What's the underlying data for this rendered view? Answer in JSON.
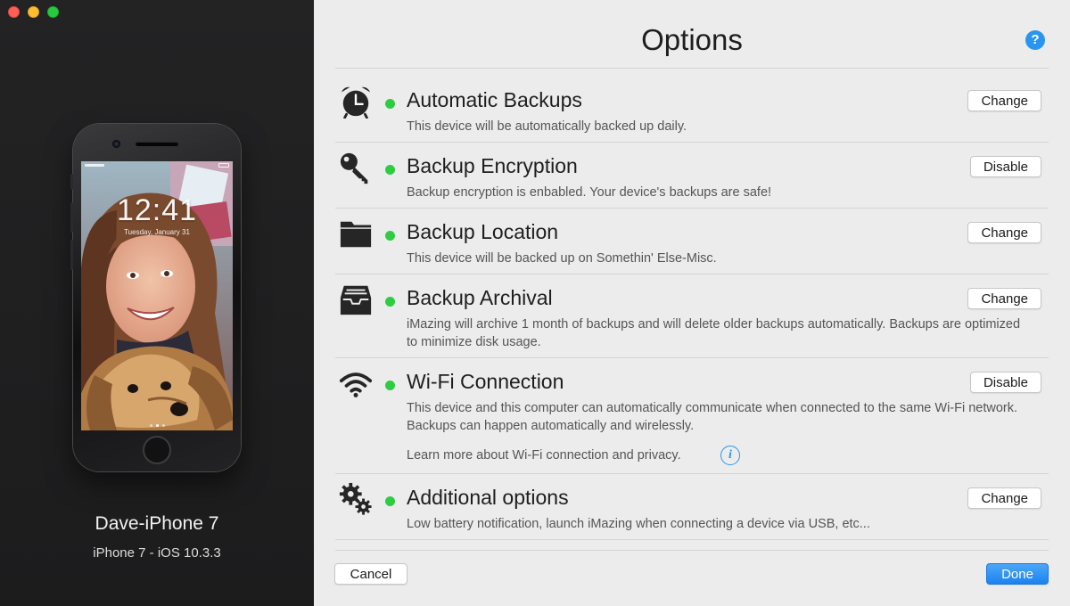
{
  "window": {
    "controls": [
      "close",
      "minimize",
      "maximize"
    ]
  },
  "device": {
    "name": "Dave-iPhone 7",
    "model": "iPhone 7 - iOS 10.3.3",
    "lock_time": "12:41",
    "lock_date": "Tuesday, January 31"
  },
  "options": {
    "title": "Options",
    "help_label": "?",
    "items": [
      {
        "icon": "alarm-clock-icon",
        "title": "Automatic Backups",
        "description": "This device will be automatically backed up daily.",
        "button": "Change",
        "status_color": "#2ecc40"
      },
      {
        "icon": "key-icon",
        "title": "Backup Encryption",
        "description": "Backup encryption is enbabled. Your device's backups are safe!",
        "button": "Disable",
        "status_color": "#2ecc40"
      },
      {
        "icon": "folder-icon",
        "title": "Backup Location",
        "description": "This device will be backed up on Somethin' Else-Misc.",
        "button": "Change",
        "status_color": "#2ecc40"
      },
      {
        "icon": "archive-tray-icon",
        "title": "Backup Archival",
        "description": "iMazing will archive 1 month of backups and will delete older backups automatically. Backups are optimized to minimize disk usage.",
        "button": "Change",
        "status_color": "#2ecc40"
      },
      {
        "icon": "wifi-icon",
        "title": "Wi-Fi Connection",
        "description": "This device and this computer can automatically communicate when connected to the same Wi-Fi network. Backups can happen automatically and wirelessly.",
        "link": "Learn more about Wi-Fi connection and privacy.",
        "link_icon": "info-icon",
        "button": "Disable",
        "status_color": "#2ecc40"
      },
      {
        "icon": "gears-icon",
        "title": "Additional options",
        "description": "Low battery notification, launch iMazing when connecting a device via USB, etc...",
        "button": "Change",
        "status_color": "#2ecc40"
      }
    ]
  },
  "footer": {
    "cancel": "Cancel",
    "done": "Done"
  },
  "colors": {
    "accent": "#2a95ee",
    "status_on": "#2ecc40",
    "left_pane": "#232324",
    "right_pane": "#ececec"
  }
}
